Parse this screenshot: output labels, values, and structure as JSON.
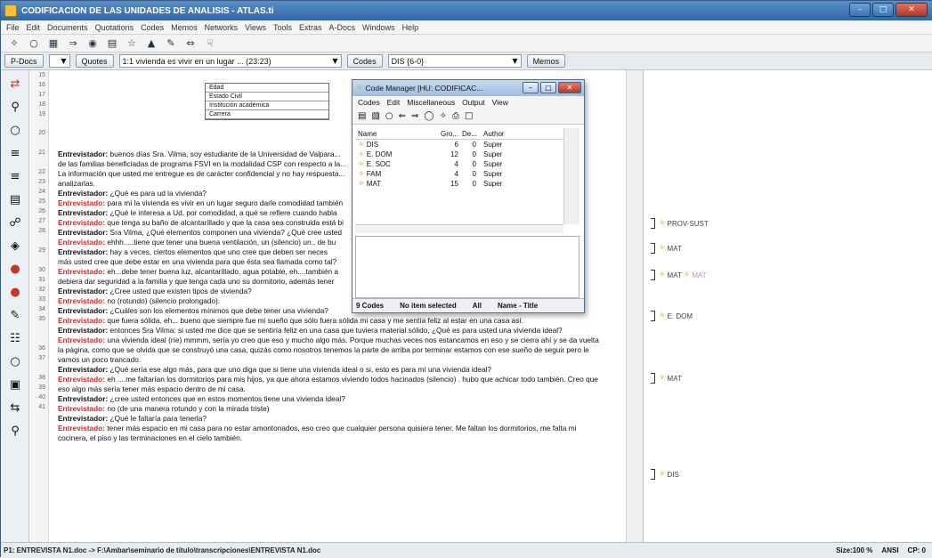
{
  "window": {
    "title": "CODIFICACION DE LAS UNIDADES DE ANALISIS - ATLAS.ti"
  },
  "menubar": [
    "File",
    "Edit",
    "Documents",
    "Quotations",
    "Codes",
    "Memos",
    "Networks",
    "Views",
    "Tools",
    "Extras",
    "A-Docs",
    "Windows",
    "Help"
  ],
  "selectors": {
    "pdoc_label": "P-Docs",
    "quotes_label": "Quotes",
    "quote_value": "1:1 vivienda es vivir en un lugar ... (23:23)",
    "codes_label": "Codes",
    "codes_value": "DIS {6-0}",
    "memos_label": "Memos"
  },
  "line_numbers": [
    "15",
    "16",
    "17",
    "18",
    "19",
    "20",
    "",
    "21",
    "",
    "22",
    "23",
    "24",
    "25",
    "26",
    "27",
    "28",
    "",
    "29",
    "",
    "30",
    "31",
    "32",
    "33",
    "34",
    "35",
    "",
    "",
    "36",
    "37",
    "",
    "38",
    "39",
    "40",
    "41",
    ""
  ],
  "doc_table": [
    "Edad",
    "Estado Civil",
    "Institución académica",
    "Carrera"
  ],
  "doc_lines": [
    {
      "speaker": "Entrevistador:",
      "text": " buenos días Sra. Vilma, soy estudiante de la Universidad de Valpara...",
      "style": "normal"
    },
    {
      "speaker": "",
      "text": "de las familias beneficiadas de programa FSVI en la modalidad CSP con respecto a la...",
      "style": "normal"
    },
    {
      "speaker": "",
      "text": "La información que usted me entregue es de carácter confidencial y no hay respuesta...",
      "style": "normal"
    },
    {
      "speaker": "",
      "text": "analizarlas.",
      "style": "normal"
    },
    {
      "speaker": "Entrevistador:",
      "text": " ¿Qué es para ud la vivienda?",
      "style": "normal"
    },
    {
      "speaker": "Entrevistado:",
      "text": " para mí la vivienda es vivir en un lugar seguro darle comodidad también",
      "style": "red-blue"
    },
    {
      "speaker": "Entrevistador:",
      "text": " ¿Qué le interesa a Ud. por comodidad, a qué se refiere cuando habla",
      "style": "normal"
    },
    {
      "speaker": "Entrevistado:",
      "text": " que tenga su baño de alcantarillado y que la casa sea construida está bi",
      "style": "red"
    },
    {
      "speaker": "Entrevistador:",
      "text": " Sra Vilma, ¿Qué elementos componen una vivienda? ¿Qué cree usted",
      "style": "normal"
    },
    {
      "speaker": "Entrevistado:",
      "text": " ehhh.....tiene que tener una buena ventilación, un (silencio) un.. de bu",
      "style": "red-yellow"
    },
    {
      "speaker": "Entrevistador:",
      "text": " hay a veces, ciertos elementos que uno cree que deben ser neces",
      "style": "normal"
    },
    {
      "speaker": "",
      "text": "más usted cree que debe estar en una vivienda para que ésta sea llamada como tal?",
      "style": "normal"
    },
    {
      "speaker": "Entrevistado:",
      "text": " eh...debe tener buena luz, alcantarillado, agua potable, eh....también a",
      "style": "red-yellow"
    },
    {
      "speaker": "",
      "text": "debiera dar seguridad a la familia y que tenga cada uno su dormitorio, además tener",
      "style": "normal"
    },
    {
      "speaker": "Entrevistador:",
      "text": " ¿Cree usted que existen tipos de vivienda?",
      "style": "normal"
    },
    {
      "speaker": "Entrevistado:",
      "text": " no (rotundo) (silencio prolongado).",
      "style": "red"
    },
    {
      "speaker": "Entrevistador:",
      "text": " ¿Cuáles son los elementos mínimos que debe tener una vivienda?",
      "style": "normal"
    },
    {
      "speaker": "Entrevistado:",
      "text": " que fuera sólida, eh... bueno que siempre fue mi sueño que sólo fuera sólida mi casa y me sentía feliz al estar en una casa así.",
      "style": "red-yellow"
    },
    {
      "speaker": "Entrevistador:",
      "text": " entonces Sra Vilma: si usted me dice que se sentiría feliz en una casa que tuviera material sólido, ¿Qué es para usted una vivienda ideal?",
      "style": "normal"
    },
    {
      "speaker": "Entrevistado:",
      "text": " una vivienda ideal (ríe) mmmm, sería yo creo que eso y mucho algo más. Porque muchas veces nos estancamos en eso y se cierra ahí y se da vuelta",
      "style": "red"
    },
    {
      "speaker": "",
      "text": "la página, como que se olvida que se construyó una casa, quizás como nosotros tenemos la parte de arriba por terminar estamos con ese sueño de seguir pero le",
      "style": "normal"
    },
    {
      "speaker": "",
      "text": "vamos un poco trancado.",
      "style": "normal"
    },
    {
      "speaker": "Entrevistador:",
      "text": " ¿Qué sería ese algo más, para que uno diga que si tiene una vivienda ideal o si, esto es para mí una vivienda ideal?",
      "style": "normal"
    },
    {
      "speaker": "Entrevistado:",
      "text": " eh ....me faltarían los dormitorios para mis hijos, ya que ahora estamos viviendo todos hacinados (silencio) . hubo que achicar todo también. Creo que",
      "style": "red"
    },
    {
      "speaker": "",
      "text": "eso algo más sería tener más espacio dentro de mi casa.",
      "style": "yellow-tail"
    },
    {
      "speaker": "Entrevistador:",
      "text": " ¿cree usted entonces que en estos momentos tiene una vivienda ideal?",
      "style": "normal"
    },
    {
      "speaker": "Entrevistado:",
      "text": " no (de una manera rotundo y con la mirada triste)",
      "style": "red"
    },
    {
      "speaker": "Entrevistador:",
      "text": " ¿Qué le faltaría para tenerla?",
      "style": "normal"
    },
    {
      "speaker": "Entrevistado:",
      "text": " tener más espacio en mi casa para no estar amontonados, eso creo que cualquier persona quisiera tener. Me faltan los dormitorios, me falta mi",
      "style": "red"
    },
    {
      "speaker": "",
      "text": "cocinera, el piso y las terminaciones en el cielo también.",
      "style": "normal"
    }
  ],
  "margin_tags": [
    {
      "codes": [
        "PROV-SUST"
      ]
    },
    {
      "codes": [
        "MAT"
      ]
    },
    {
      "codes": [
        "MAT",
        "MAT"
      ]
    },
    {
      "codes": [
        "E. DOM"
      ]
    },
    {
      "codes": [
        "MAT"
      ]
    },
    {
      "codes": [
        "DIS"
      ]
    }
  ],
  "code_manager": {
    "title": "Code Manager [HU: CODIFICAC...",
    "menu": [
      "Codes",
      "Edit",
      "Miscellaneous",
      "Output",
      "View"
    ],
    "columns": [
      "Name",
      "Gro...",
      "De...",
      "Author"
    ],
    "rows": [
      {
        "name": "DIS",
        "gro": "6",
        "de": "0",
        "author": "Super"
      },
      {
        "name": "E. DOM",
        "gro": "12",
        "de": "0",
        "author": "Super"
      },
      {
        "name": "E. SOC",
        "gro": "4",
        "de": "0",
        "author": "Super"
      },
      {
        "name": "FAM",
        "gro": "4",
        "de": "0",
        "author": "Super"
      },
      {
        "name": "MAT",
        "gro": "15",
        "de": "0",
        "author": "Super"
      }
    ],
    "status_count": "9 Codes",
    "status_sel": "No item selected",
    "status_filter": "All",
    "status_sort": "Name - Title"
  },
  "statusbar": {
    "path": "P1: ENTREVISTA N1.doc -> F:\\Ambar\\seminario de titulo\\transcripciones\\ENTREVISTA N1.doc",
    "size": "Size:100 %",
    "encoding": "ANSI",
    "cp": "CP: 0"
  }
}
